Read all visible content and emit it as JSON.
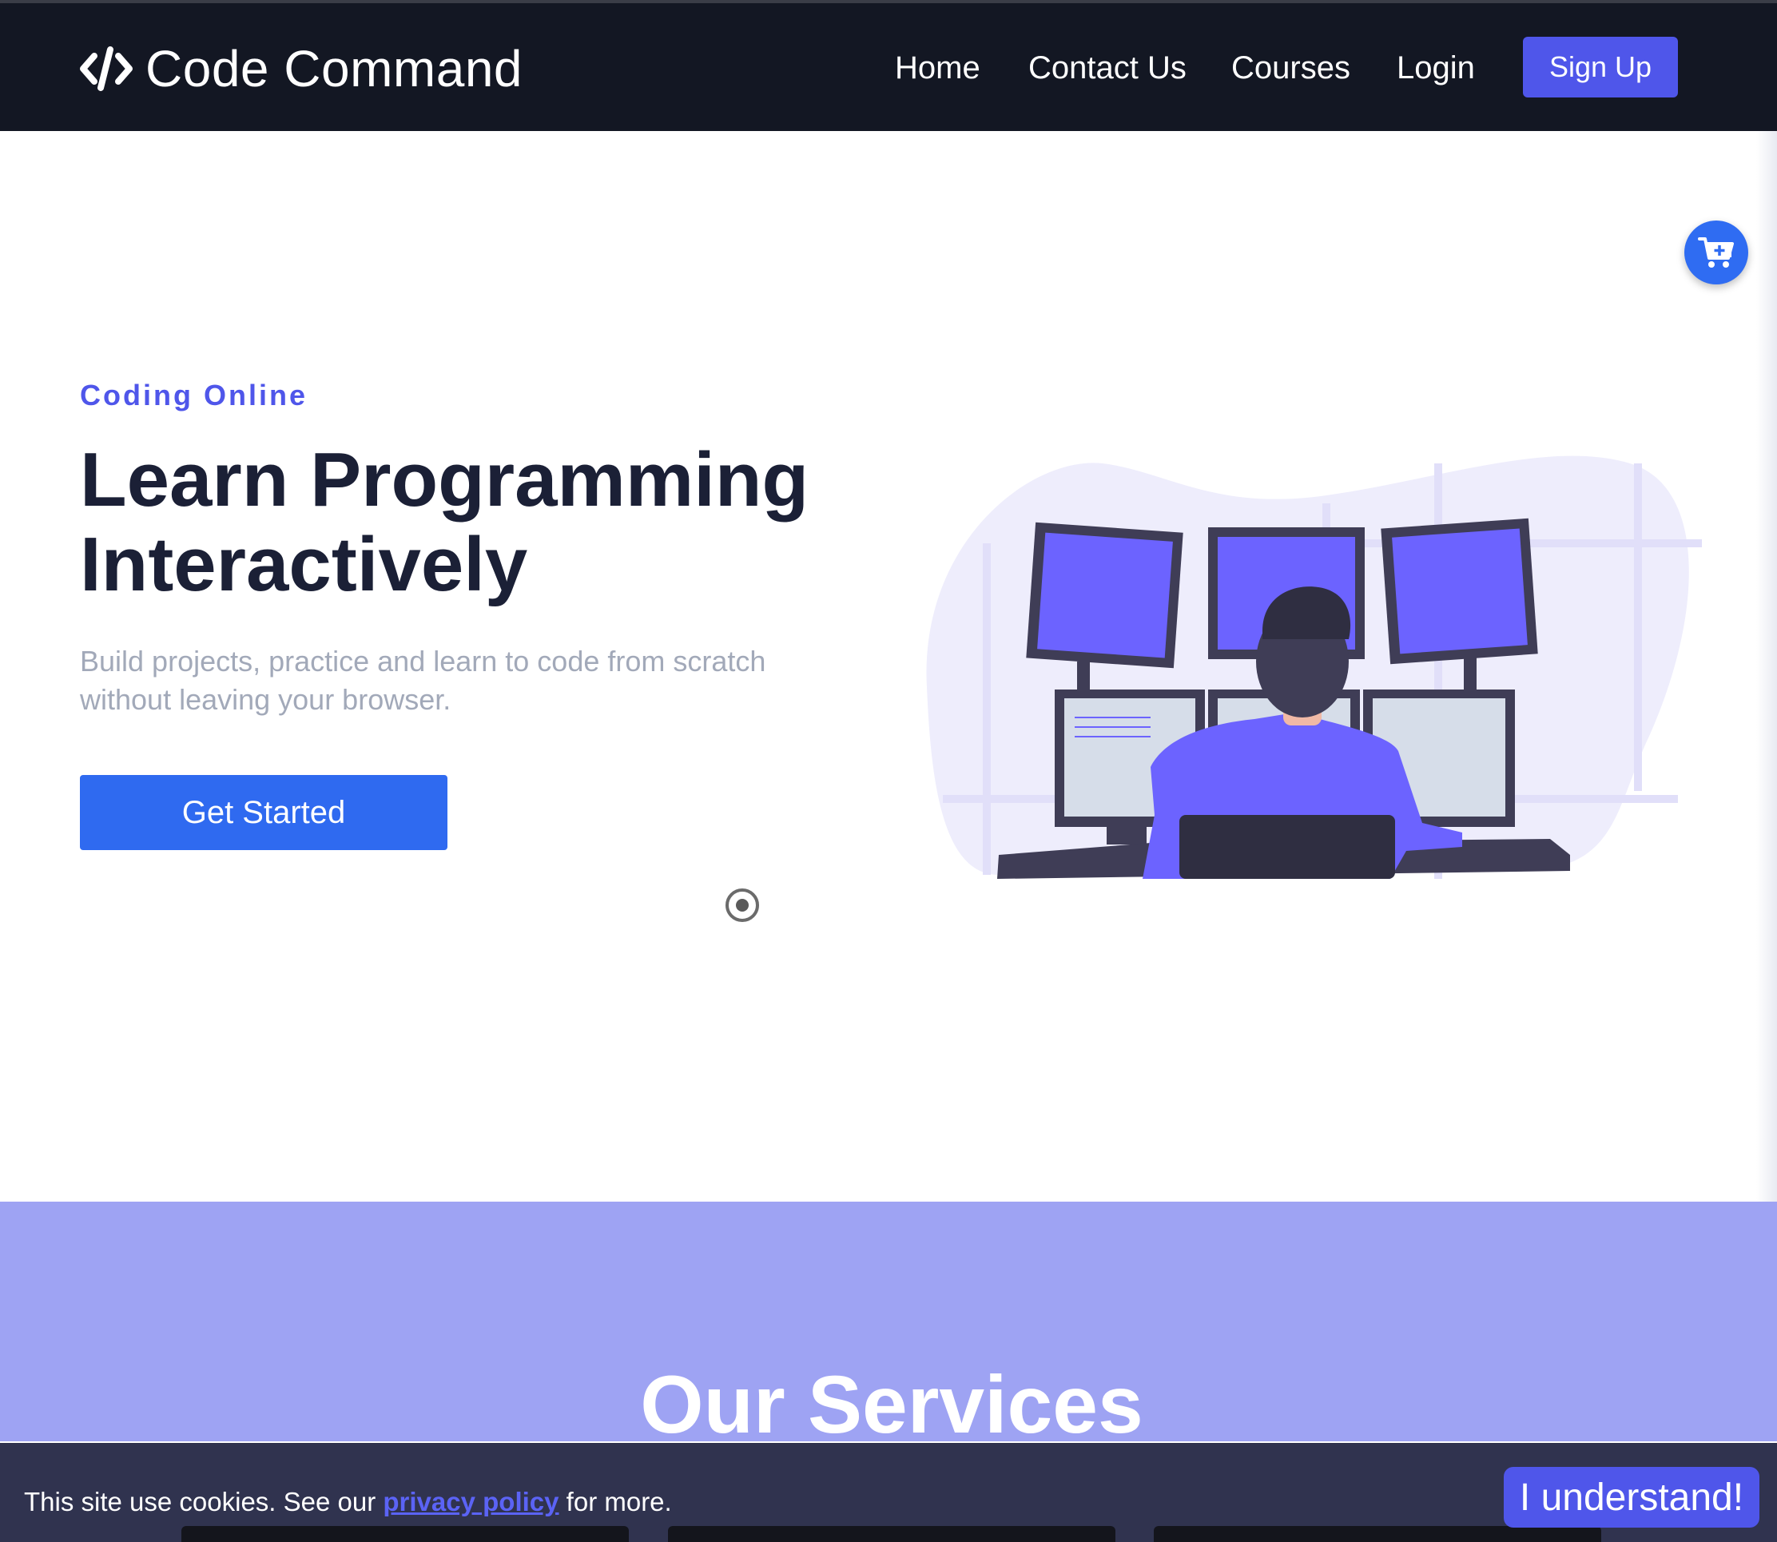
{
  "brand": {
    "name": "Code Command",
    "icon": "code-brackets-icon"
  },
  "nav": {
    "items": [
      {
        "label": "Home"
      },
      {
        "label": "Contact Us"
      },
      {
        "label": "Courses"
      },
      {
        "label": "Login"
      }
    ],
    "signup_label": "Sign Up"
  },
  "cart": {
    "icon": "cart-plus-icon"
  },
  "hero": {
    "eyebrow": "Coding Online",
    "title_line1": "Learn Programming",
    "title_line2": "Interactively",
    "subtitle_line1": "Build projects, practice and learn to code from scratch",
    "subtitle_line2": "without leaving your browser.",
    "cta_label": "Get Started",
    "illustration": "programmer-at-monitors-illustration"
  },
  "services": {
    "title": "Our Services"
  },
  "cookie": {
    "text_before": "This site use cookies. See our ",
    "link_label": "privacy policy",
    "text_after": " for more.",
    "button_label": "I understand!"
  },
  "colors": {
    "navbar_bg": "#131723",
    "accent": "#4f56ea",
    "cta_blue": "#2f6af0",
    "heading": "#1b2036",
    "muted": "#a2a9b9",
    "services_bg": "#9ea3f3",
    "cookie_bg": "#30334f"
  }
}
